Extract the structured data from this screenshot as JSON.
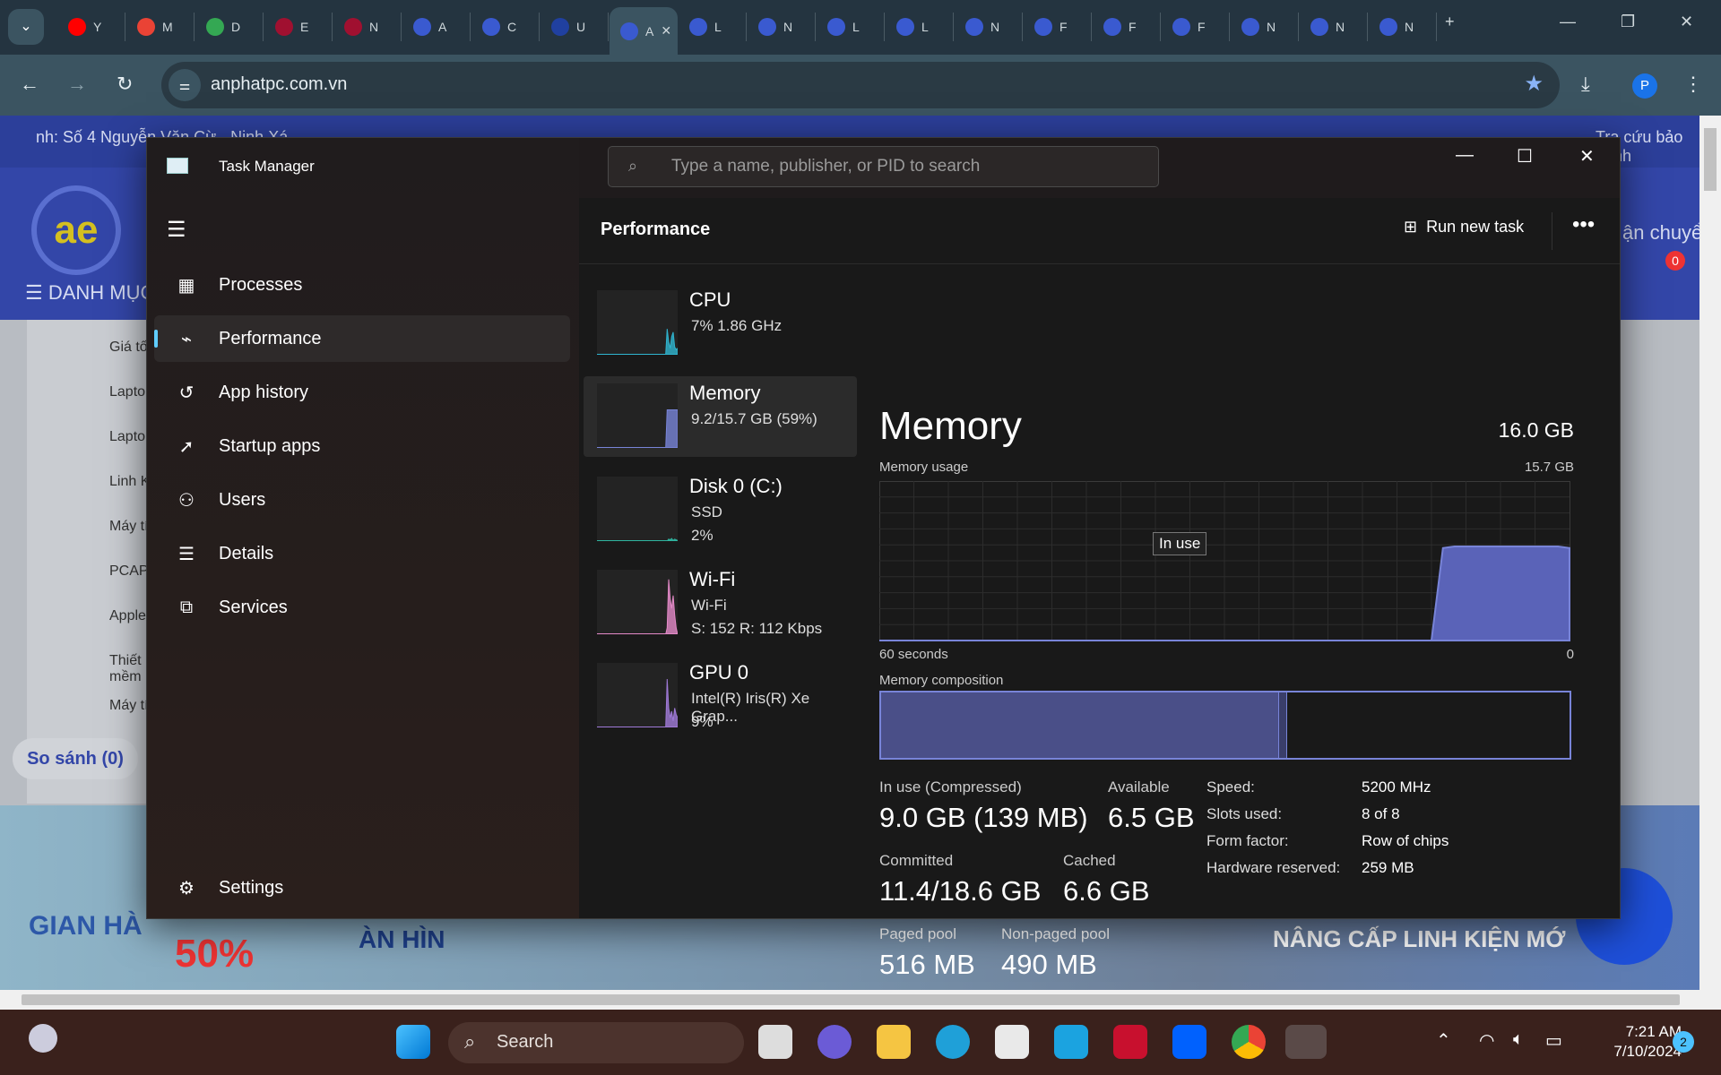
{
  "browser": {
    "tabs": [
      {
        "label": "Y",
        "icon": "youtube-icon",
        "color": "#ff0000"
      },
      {
        "label": "M",
        "icon": "gmail-icon",
        "color": "#ea4335"
      },
      {
        "label": "D",
        "icon": "drive-icon",
        "color": "#34a853"
      },
      {
        "label": "E",
        "icon": "e-icon",
        "color": "#a01030"
      },
      {
        "label": "N",
        "icon": "e-icon",
        "color": "#a01030"
      },
      {
        "label": "A",
        "icon": "anphat-icon",
        "color": "#3a5ad0"
      },
      {
        "label": "C",
        "icon": "anphat-icon",
        "color": "#3a5ad0"
      },
      {
        "label": "U",
        "icon": "anphat-icon",
        "color": "#2040a0"
      },
      {
        "label": "A",
        "icon": "anphat-icon",
        "color": "#3a5ad0",
        "active": true
      },
      {
        "label": "L",
        "icon": "anphat-icon",
        "color": "#3a5ad0"
      },
      {
        "label": "N",
        "icon": "anphat-icon",
        "color": "#3a5ad0"
      },
      {
        "label": "L",
        "icon": "anphat-icon",
        "color": "#3a5ad0"
      },
      {
        "label": "L",
        "icon": "anphat-icon",
        "color": "#3a5ad0"
      },
      {
        "label": "N",
        "icon": "anphat-icon",
        "color": "#3a5ad0"
      },
      {
        "label": "F",
        "icon": "anphat-icon",
        "color": "#3a5ad0"
      },
      {
        "label": "F",
        "icon": "anphat-icon",
        "color": "#3a5ad0"
      },
      {
        "label": "F",
        "icon": "anphat-icon",
        "color": "#3a5ad0"
      },
      {
        "label": "N",
        "icon": "anphat-icon",
        "color": "#3a5ad0"
      },
      {
        "label": "N",
        "icon": "anphat-icon",
        "color": "#3a5ad0"
      },
      {
        "label": "N",
        "icon": "anphat-icon",
        "color": "#3a5ad0"
      }
    ],
    "url": "anphatpc.com.vn",
    "profile_initial": "P"
  },
  "website": {
    "topbar_text": "nh: Số 4 Nguyễn Văn Cừ - Ninh Xá",
    "topbar_right": "Tra cứu bảo hành",
    "category_label": "DANH MỤC",
    "right_label": "ận chuyển",
    "cart_count": "0",
    "menu": [
      "Giá tốt - S",
      "Laptop Ga",
      "Laptop - T",
      "Linh Kiện",
      "Máy tính",
      "PCAP Má",
      "Apple",
      "Thiết bị và mềm",
      "Máy tính -"
    ],
    "compare": "So sánh (0)",
    "banner_left": "GIAN HÀ",
    "banner_discount": "50%",
    "banner_mid": "ÀN HÌN",
    "banner_right": "NÂNG CẤP LINH KIỆN MỚ"
  },
  "taskmanager": {
    "title": "Task Manager",
    "search_placeholder": "Type a name, publisher, or PID to search",
    "nav": [
      {
        "label": "Processes",
        "icon": "processes-icon",
        "glyph": "▦"
      },
      {
        "label": "Performance",
        "icon": "performance-icon",
        "glyph": "⌁",
        "selected": true
      },
      {
        "label": "App history",
        "icon": "app-history-icon",
        "glyph": "↺"
      },
      {
        "label": "Startup apps",
        "icon": "startup-icon",
        "glyph": "➚"
      },
      {
        "label": "Users",
        "icon": "users-icon",
        "glyph": "⚇"
      },
      {
        "label": "Details",
        "icon": "details-icon",
        "glyph": "☰"
      },
      {
        "label": "Services",
        "icon": "services-icon",
        "glyph": "⧉"
      }
    ],
    "settings": "Settings",
    "page_title": "Performance",
    "run_new_task": "Run new task",
    "devices": [
      {
        "name": "CPU",
        "line1": "7%  1.86 GHz",
        "line2": "",
        "color": "#2fb5d0",
        "history": [
          0,
          0,
          0,
          0,
          0,
          0,
          0,
          0,
          0,
          0,
          0,
          0,
          0,
          0,
          0,
          0,
          0,
          0,
          0,
          0,
          0,
          0,
          0,
          0,
          0,
          0,
          0,
          0,
          0,
          0,
          0,
          0,
          0,
          0,
          0,
          0,
          0,
          0,
          0,
          0,
          0,
          0,
          0,
          0,
          0,
          0,
          1,
          40,
          20,
          10,
          28,
          35,
          12,
          8,
          10
        ]
      },
      {
        "name": "Memory",
        "line1": "9.2/15.7 GB (59%)",
        "line2": "",
        "color": "#7884d8",
        "selected": true,
        "history": [
          0,
          0,
          0,
          0,
          0,
          0,
          0,
          0,
          0,
          0,
          0,
          0,
          0,
          0,
          0,
          0,
          0,
          0,
          0,
          0,
          0,
          0,
          0,
          0,
          0,
          0,
          0,
          0,
          0,
          0,
          0,
          0,
          0,
          0,
          0,
          0,
          0,
          0,
          0,
          0,
          0,
          0,
          0,
          0,
          0,
          0,
          0,
          59,
          59,
          59,
          59,
          59,
          59,
          59,
          59
        ]
      },
      {
        "name": "Disk 0 (C:)",
        "line1": "SSD",
        "line2": "2%",
        "color": "#2fb5a0",
        "history": [
          0,
          0,
          0,
          0,
          0,
          0,
          0,
          0,
          0,
          0,
          0,
          0,
          0,
          0,
          0,
          0,
          0,
          0,
          0,
          0,
          0,
          0,
          0,
          0,
          0,
          0,
          0,
          0,
          0,
          0,
          0,
          0,
          0,
          0,
          0,
          0,
          0,
          0,
          0,
          0,
          0,
          0,
          0,
          0,
          0,
          0,
          0,
          0,
          3,
          2,
          4,
          1,
          3,
          2,
          1
        ]
      },
      {
        "name": "Wi-Fi",
        "line1": "Wi-Fi",
        "line2": "S: 152  R: 112 Kbps",
        "color": "#e48ac8",
        "history": [
          0,
          0,
          0,
          0,
          0,
          0,
          0,
          0,
          0,
          0,
          0,
          0,
          0,
          0,
          0,
          0,
          0,
          0,
          0,
          0,
          0,
          0,
          0,
          0,
          0,
          0,
          0,
          0,
          0,
          0,
          0,
          0,
          0,
          0,
          0,
          0,
          0,
          0,
          0,
          0,
          0,
          0,
          0,
          0,
          0,
          0,
          0,
          10,
          85,
          55,
          40,
          60,
          30,
          10,
          0
        ]
      },
      {
        "name": "GPU 0",
        "line1": "Intel(R) Iris(R) Xe Grap...",
        "line2": "9%",
        "color": "#a07ad8",
        "history": [
          0,
          0,
          0,
          0,
          0,
          0,
          0,
          0,
          0,
          0,
          0,
          0,
          0,
          0,
          0,
          0,
          0,
          0,
          0,
          0,
          0,
          0,
          0,
          0,
          0,
          0,
          0,
          0,
          0,
          0,
          0,
          0,
          0,
          0,
          0,
          0,
          0,
          0,
          0,
          0,
          0,
          0,
          0,
          0,
          0,
          0,
          0,
          75,
          30,
          15,
          25,
          10,
          30,
          20,
          15
        ]
      }
    ],
    "memory": {
      "title": "Memory",
      "total": "16.0 GB",
      "usage_label": "Memory usage",
      "usage_max": "15.7 GB",
      "in_use_tooltip": "In use",
      "time_left": "60 seconds",
      "time_right": "0",
      "usage_history_percent": [
        0,
        0,
        0,
        0,
        0,
        0,
        0,
        0,
        0,
        0,
        0,
        0,
        0,
        0,
        0,
        0,
        0,
        0,
        0,
        0,
        0,
        0,
        0,
        0,
        0,
        0,
        0,
        0,
        0,
        0,
        0,
        0,
        0,
        0,
        0,
        0,
        0,
        0,
        0,
        0,
        0,
        0,
        0,
        0,
        0,
        0,
        0,
        0,
        0,
        58,
        59,
        59,
        59,
        59,
        59,
        59,
        59,
        59,
        59,
        59,
        58
      ],
      "composition_label": "Memory composition",
      "composition": {
        "in_use_fraction": 0.578,
        "modified_fraction": 0.012
      },
      "stats": [
        {
          "label": "In use (Compressed)",
          "value": "9.0 GB (139 MB)"
        },
        {
          "label": "Available",
          "value": "6.5 GB"
        },
        {
          "label": "Committed",
          "value": "11.4/18.6 GB"
        },
        {
          "label": "Cached",
          "value": "6.6 GB"
        },
        {
          "label": "Paged pool",
          "value": "516 MB"
        },
        {
          "label": "Non-paged pool",
          "value": "490 MB"
        }
      ],
      "specs": [
        {
          "label": "Speed:",
          "value": "5200 MHz"
        },
        {
          "label": "Slots used:",
          "value": "8 of 8"
        },
        {
          "label": "Form factor:",
          "value": "Row of chips"
        },
        {
          "label": "Hardware reserved:",
          "value": "259 MB"
        }
      ]
    }
  },
  "taskbar": {
    "search": "Search",
    "time": "7:21 AM",
    "date": "7/10/2024",
    "notifications": "2"
  }
}
